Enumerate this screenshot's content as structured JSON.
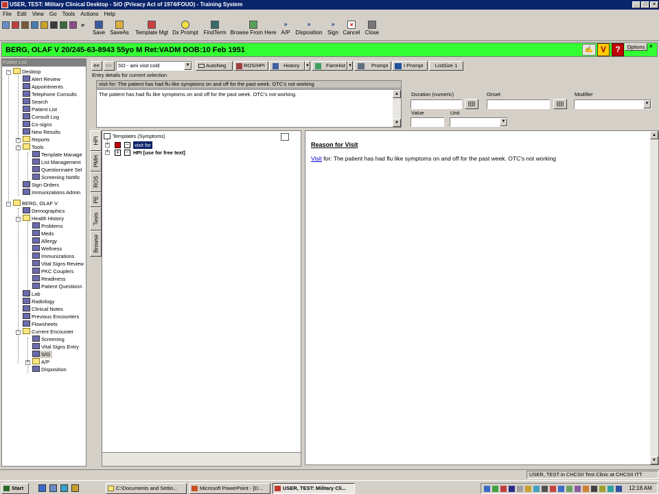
{
  "window": {
    "title": "USER, TEST: Military Clinical Desktop - S/O (Privacy Act of 1974/FOUO) - Training System"
  },
  "menu": [
    "File",
    "Edit",
    "View",
    "Go",
    "Tools",
    "Actions",
    "Help"
  ],
  "toolbar": {
    "buttons": [
      "Save",
      "SaveAs",
      "Template Mgt",
      "Dx Prompt",
      "FindTerm",
      "Browse From Here",
      "A/P",
      "Disposition",
      "Sign",
      "Cancel",
      "Close"
    ]
  },
  "patient_banner": {
    "text": "BERG, OLAF V 20/245-63-8943 55yo M Ret:VADM DOB:10 Feb 1951",
    "options_label": "Options",
    "background": "#33ff33"
  },
  "folder_list": {
    "header": "Folder List",
    "items": [
      "Desktop",
      "Alert Review",
      "Appointments",
      "Telephone Consults",
      "Search",
      "Patient List",
      "Consult Log",
      "Co-signs",
      "New Results",
      "Reports",
      "Tools",
      "Template Manage",
      "List Management",
      "Questionnaire Sel",
      "Screening Notific",
      "Sign Orders",
      "Immunizations Admin",
      "BERG, OLAF V",
      "Demographics",
      "Health History",
      "Problems",
      "Meds",
      "Allergy",
      "Wellness",
      "Immunizations",
      "Vital Signs Review",
      "PKC Couplers",
      "Readiness",
      "Patient Questionn",
      "Lab",
      "Radiology",
      "Clinical Notes",
      "Previous Encounters",
      "Flowsheets",
      "Current Encounter",
      "Screening",
      "Vital Signs Entry",
      "S/O",
      "A/P",
      "Disposition"
    ]
  },
  "so_toolbar": {
    "back": "<<",
    "forward": ">>",
    "template_select": "SO - ami visit cold",
    "buttons": [
      "AutoNeg",
      "ROS/HPI",
      "History",
      "FamHist",
      "Prompt",
      "I Prompt",
      "ListSize 1"
    ]
  },
  "entry": {
    "group_label": "Entry details for current selection",
    "summary": "visit for: The patient has had flu like symptoms on and off for the past week.  OTC's not working",
    "text": "The patient has had flu like symptoms on and off for the past week.  OTC's not working.",
    "duration_label": "Duration (numeric)",
    "onset_label": "Onset",
    "modifier_label": "Modifier",
    "value_label": "Value",
    "unit_label": "Unit"
  },
  "vertical_tabs": [
    "HPI",
    "PMH",
    "ROS",
    "PE",
    "Tests",
    "Browse"
  ],
  "templates": {
    "root": "Templates (Symptoms)",
    "items": [
      "visit for",
      "HPI [use for free text]"
    ]
  },
  "note": {
    "heading": "Reason for Visit",
    "link": "Visit",
    "text": " for: The patient has had flu like symptoms on and off for the past week. OTC's not working"
  },
  "status_bar": {
    "text": "USER, TEST in CHCSII Test Clinic at CHCSII ITT"
  },
  "taskbar": {
    "start": "Start",
    "tasks": [
      "C:\\Documents and Settin...",
      "Microsoft PowerPoint - [D...",
      "USER, TEST: Military Cli..."
    ],
    "clock": "12:18 AM"
  }
}
